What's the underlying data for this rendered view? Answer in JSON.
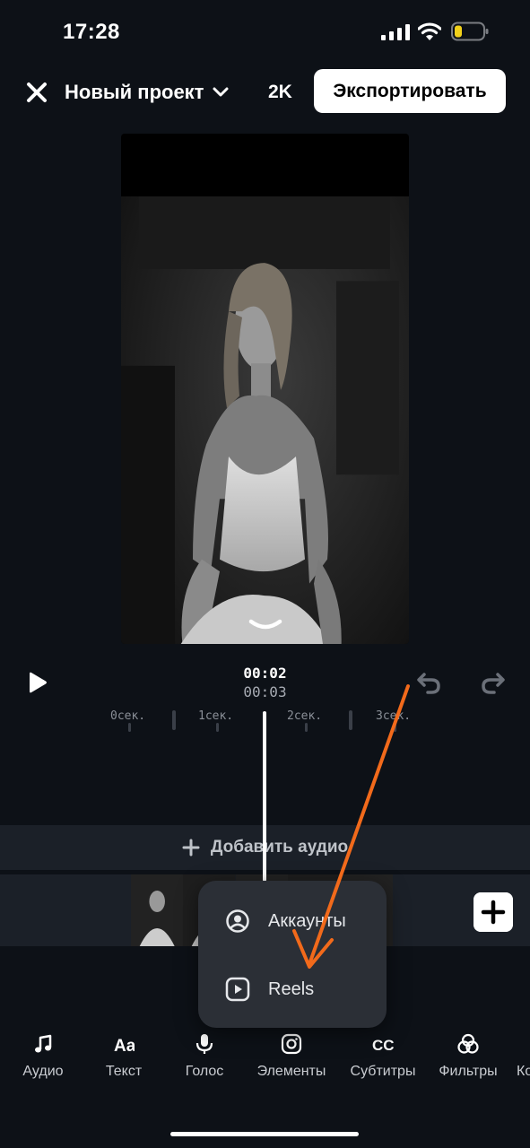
{
  "status_bar": {
    "time": "17:28",
    "battery_color": "#f2d11a"
  },
  "header": {
    "project_title": "Новый проект",
    "quality": "2K",
    "export_label": "Экспортировать"
  },
  "playback": {
    "current_time": "00:02",
    "total_time": "00:03"
  },
  "ruler": {
    "labels": [
      "0сек.",
      "1сек.",
      "2сек.",
      "3сек."
    ]
  },
  "audio": {
    "add_label": "Добавить аудио"
  },
  "popup_menu": {
    "items": [
      {
        "label": "Аккаунты",
        "icon": "account-circle-icon"
      },
      {
        "label": "Reels",
        "icon": "reels-icon"
      }
    ]
  },
  "toolbar": {
    "items": [
      {
        "label": "Аудио",
        "icon": "music-note-icon"
      },
      {
        "label": "Текст",
        "icon": "text-aa-icon"
      },
      {
        "label": "Голос",
        "icon": "microphone-icon"
      },
      {
        "label": "Элементы",
        "icon": "instagram-icon"
      },
      {
        "label": "Субтитры",
        "icon": "cc-icon"
      },
      {
        "label": "Фильтры",
        "icon": "filters-icon"
      },
      {
        "label": "Ко",
        "icon": ""
      }
    ]
  },
  "colors": {
    "background": "#0d1117",
    "panel": "#1b2028",
    "annotation_arrow": "#f26a1b"
  }
}
